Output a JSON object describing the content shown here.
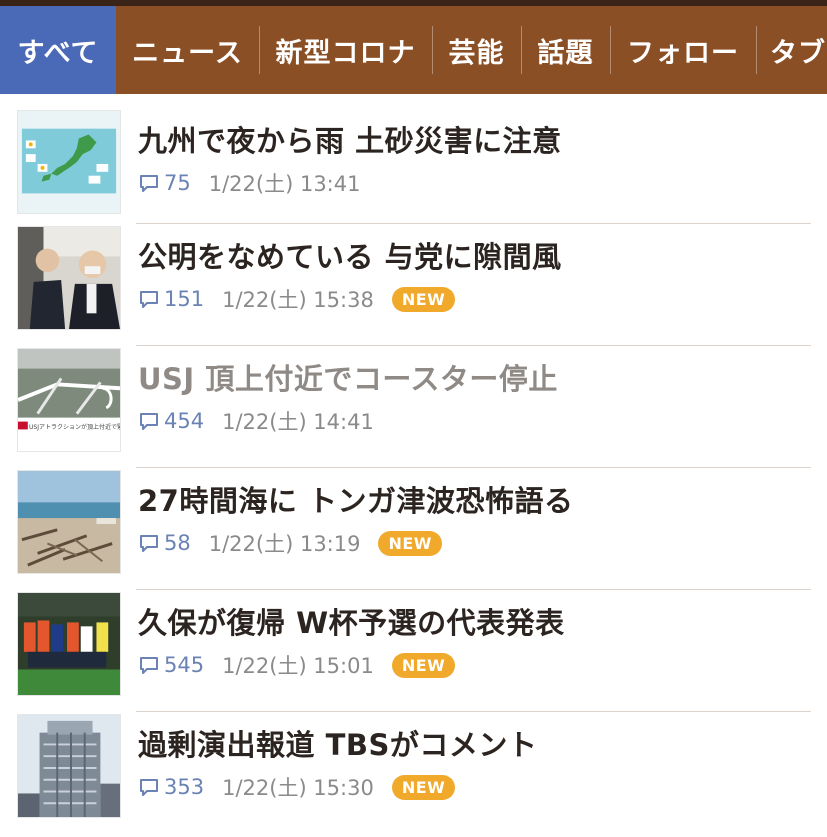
{
  "tabs": [
    {
      "label": "すべて",
      "active": true
    },
    {
      "label": "ニュース",
      "active": false
    },
    {
      "label": "新型コロナ",
      "active": false
    },
    {
      "label": "芸能",
      "active": false
    },
    {
      "label": "話題",
      "active": false
    },
    {
      "label": "フォロー",
      "active": false
    },
    {
      "label": "タブ",
      "active": false
    }
  ],
  "articles": [
    {
      "title": "九州で夜から雨 土砂災害に注意",
      "comments": "75",
      "time": "1/22(土) 13:41",
      "is_new": false,
      "read": false,
      "thumb_icon": "weather-map-thumbnail"
    },
    {
      "title": "公明をなめている 与党に隙間風",
      "comments": "151",
      "time": "1/22(土) 15:38",
      "is_new": true,
      "read": false,
      "thumb_icon": "politicians-thumbnail"
    },
    {
      "title": "USJ 頂上付近でコースター停止",
      "comments": "454",
      "time": "1/22(土) 14:41",
      "is_new": false,
      "read": true,
      "thumb_icon": "roller-coaster-thumbnail",
      "thumb_caption": "USJアトラクションが頂上付近で緊急停止"
    },
    {
      "title": "27時間海に トンガ津波恐怖語る",
      "comments": "58",
      "time": "1/22(土) 13:19",
      "is_new": true,
      "read": false,
      "thumb_icon": "tsunami-debris-thumbnail"
    },
    {
      "title": "久保が復帰 W杯予選の代表発表",
      "comments": "545",
      "time": "1/22(土) 15:01",
      "is_new": true,
      "read": false,
      "thumb_icon": "soccer-team-thumbnail"
    },
    {
      "title": "過剰演出報道 TBSがコメント",
      "comments": "353",
      "time": "1/22(土) 15:30",
      "is_new": true,
      "read": false,
      "thumb_icon": "tbs-building-thumbnail"
    }
  ],
  "badge_label": "NEW",
  "colors": {
    "tabbar": "#8b4f25",
    "active_tab": "#4a69b6",
    "new_badge": "#f0a92a",
    "comment_count": "#6a83b4"
  }
}
